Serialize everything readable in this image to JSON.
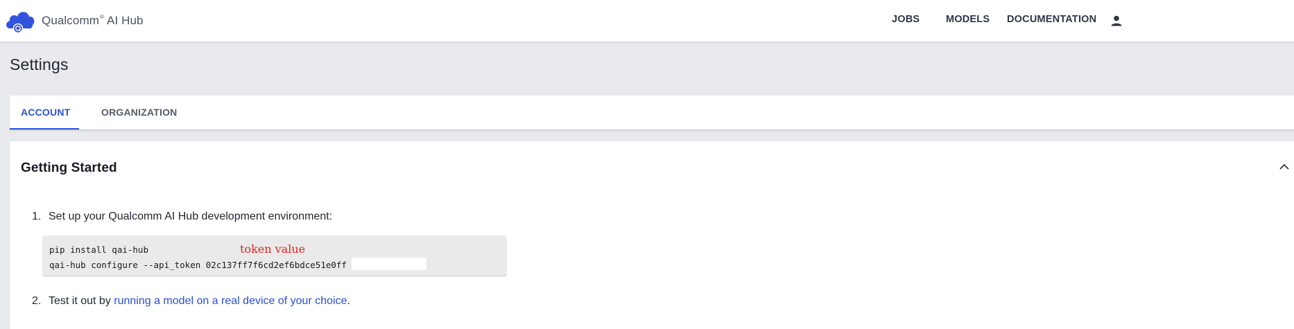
{
  "header": {
    "brand_name": "Qualcomm",
    "brand_reg": "®",
    "brand_suffix": "AI Hub",
    "nav": {
      "jobs": "JOBS",
      "models": "MODELS",
      "documentation": "DOCUMENTATION"
    },
    "user_icon": "person-icon"
  },
  "page": {
    "title": "Settings"
  },
  "tabs": [
    {
      "label": "ACCOUNT",
      "active": true
    },
    {
      "label": "ORGANIZATION",
      "active": false
    }
  ],
  "card": {
    "title": "Getting Started",
    "collapse_icon": "chevron-up-icon",
    "step1": {
      "number": "1.",
      "text": "Set up your Qualcomm AI Hub development environment:"
    },
    "code": {
      "line1": "pip install qai-hub",
      "line2": "qai-hub configure --api_token 02c137ff7f6cd2ef6bdce51e0ff"
    },
    "annotation": "token value",
    "step2": {
      "number": "2.",
      "prefix": "Test it out by ",
      "link": "running a model on a real device of your choice",
      "suffix": "."
    }
  },
  "colors": {
    "accent": "#2a4fd6",
    "annotation": "#e2231a",
    "background": "#e9eaed",
    "brand_blue": "#3253dc"
  }
}
